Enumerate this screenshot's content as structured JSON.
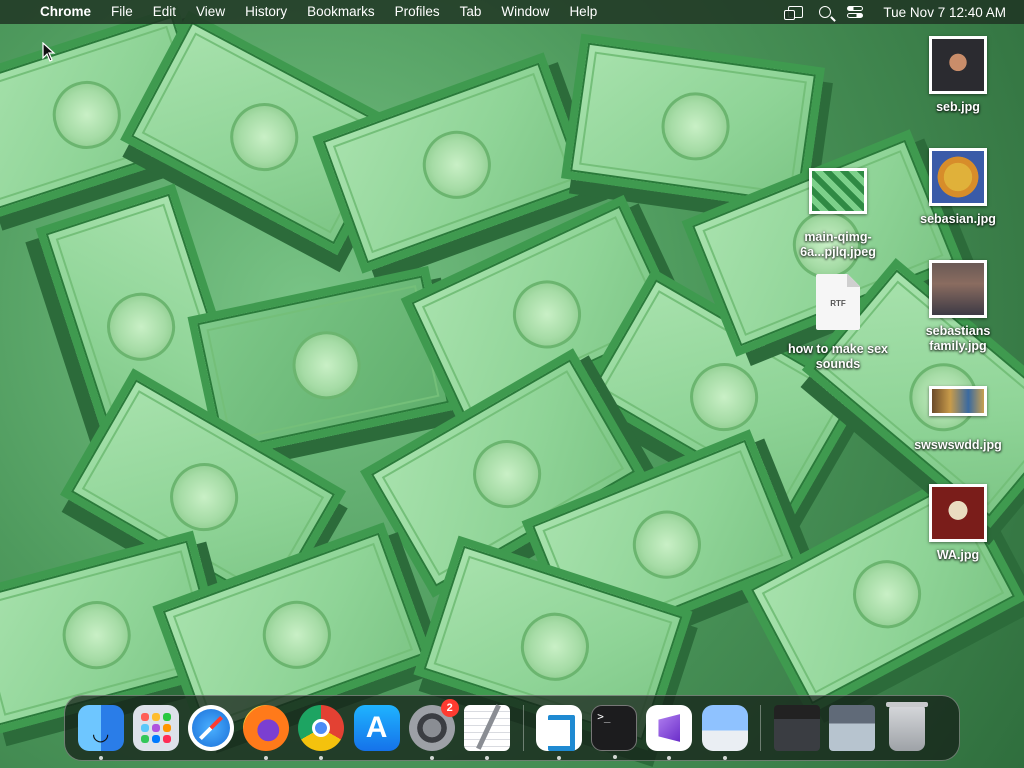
{
  "menubar": {
    "apple_glyph": "",
    "app_name": "Chrome",
    "menus": [
      "File",
      "Edit",
      "View",
      "History",
      "Bookmarks",
      "Profiles",
      "Tab",
      "Window",
      "Help"
    ],
    "status_icons": [
      "screen-mirroring-icon",
      "search-icon",
      "control-center-icon"
    ],
    "clock": "Tue Nov 7  12:40 AM"
  },
  "desktop": {
    "wallpaper": "green-money-stacks",
    "icons": [
      {
        "name": "seb.jpg"
      },
      {
        "name": "sebasian.jpg"
      },
      {
        "name": "sebastians family.jpg"
      },
      {
        "name": "swswswdd.jpg"
      },
      {
        "name": "WA.jpg"
      },
      {
        "name": "main-qimg-6a...pjlq.jpeg"
      },
      {
        "name": "how to make sex sounds",
        "badge": "RTF"
      }
    ]
  },
  "dock": {
    "apps": [
      {
        "name": "Finder",
        "icon": "finder-icon"
      },
      {
        "name": "Launchpad",
        "icon": "launchpad-icon"
      },
      {
        "name": "Safari",
        "icon": "safari-icon"
      },
      {
        "name": "Firefox",
        "icon": "firefox-icon"
      },
      {
        "name": "Google Chrome",
        "icon": "chrome-icon"
      },
      {
        "name": "App Store",
        "icon": "app-store-icon"
      },
      {
        "name": "System Settings",
        "icon": "settings-icon",
        "badge": "2"
      },
      {
        "name": "TextEdit",
        "icon": "textedit-icon"
      },
      {
        "name": "Visual Studio Code",
        "icon": "vscode-icon"
      },
      {
        "name": "Terminal",
        "icon": "terminal-icon",
        "glyph": ">_"
      },
      {
        "name": "Visual Studio",
        "icon": "visual-studio-icon"
      },
      {
        "name": "Preview",
        "icon": "preview-icon"
      }
    ],
    "trash_icon": "trash-icon"
  },
  "colors": {
    "menubar_bg": "#1e3222",
    "badge_red": "#ff3b30",
    "wallpaper_green": "#4e9a5d"
  }
}
